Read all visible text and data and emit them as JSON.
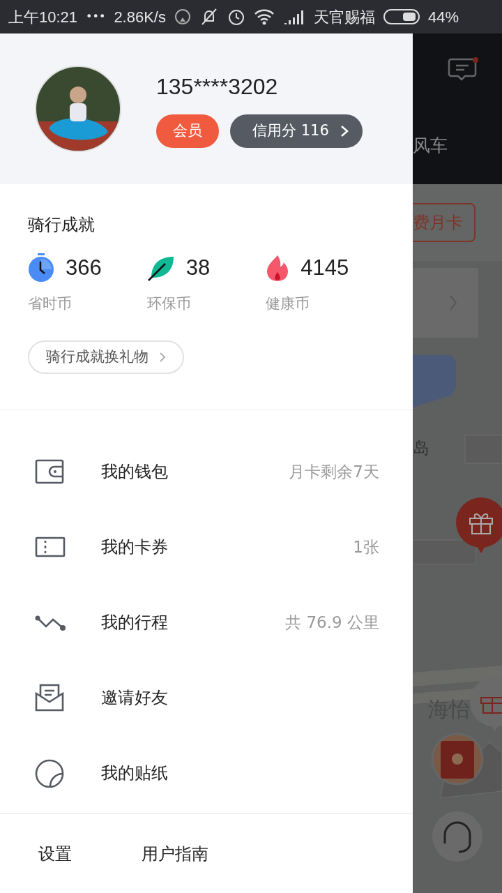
{
  "status_bar": {
    "time": "上午10:21",
    "more": "•••",
    "speed": "2.86K/s",
    "carrier": "天官赐福",
    "battery": "44%"
  },
  "profile": {
    "phone": "135****3202",
    "member_badge": "会员",
    "credit": "信用分 116"
  },
  "achievements": {
    "title": "骑行成就",
    "coins": [
      {
        "kind": "time",
        "value": "366",
        "label": "省时币"
      },
      {
        "kind": "eco",
        "value": "38",
        "label": "环保币"
      },
      {
        "kind": "health",
        "value": "4145",
        "label": "健康币"
      }
    ],
    "gift_button": "骑行成就换礼物"
  },
  "menu": [
    {
      "kind": "wallet",
      "label": "我的钱包",
      "detail": "月卡剩余7天"
    },
    {
      "kind": "coupon",
      "label": "我的卡券",
      "detail": "1张"
    },
    {
      "kind": "trips",
      "label": "我的行程",
      "detail": "共 76.9 公里"
    },
    {
      "kind": "invite",
      "label": "邀请好友"
    },
    {
      "kind": "sticker",
      "label": "我的贴纸"
    }
  ],
  "footer": [
    "设置",
    "用户指南"
  ],
  "background": {
    "header_text": "风车",
    "unread": true,
    "card_button": "费月卡",
    "map_labels": [
      "岛",
      "海怡"
    ]
  }
}
